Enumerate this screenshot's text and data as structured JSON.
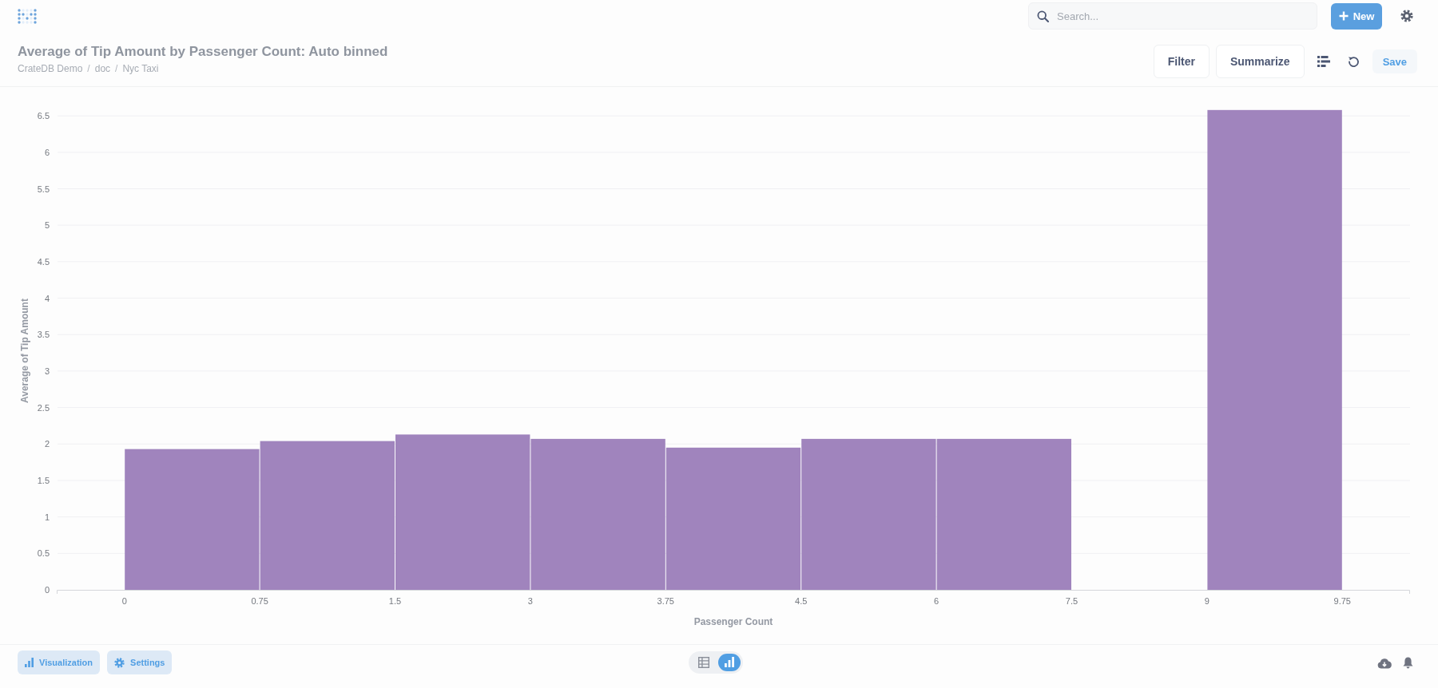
{
  "top_nav": {
    "search": {
      "placeholder": "Search..."
    },
    "new_button": {
      "label": "New"
    }
  },
  "question": {
    "title": "Average of Tip Amount by Passenger Count: Auto binned",
    "breadcrumb": [
      {
        "text": "CrateDB Demo",
        "separator": "/"
      },
      {
        "text": "doc",
        "separator": "/"
      },
      {
        "text": "Nyc Taxi"
      }
    ],
    "buttons": [
      "Filter",
      "Summarize"
    ],
    "save_button": {
      "label": "Save"
    }
  },
  "chart": {
    "chart_data": {
      "type": "bar",
      "xlabel": "Passenger Count",
      "ylabel": "Average of Tip Amount",
      "categories": [
        "0",
        "0.75",
        "1.5",
        "3",
        "3.75",
        "4.5",
        "6",
        "7.5",
        "9",
        "9.75"
      ],
      "series": [
        {
          "color": "#a084bd",
          "values": [
            1.93,
            2.04,
            2.13,
            2.07,
            1.95,
            2.07,
            2.07,
            null,
            6.58,
            null
          ]
        }
      ],
      "yticks": [
        0,
        0.5,
        1,
        1.5,
        2,
        2.5,
        3,
        3.5,
        4,
        4.5,
        5,
        5.5,
        6,
        6.5
      ],
      "ylim": [
        0,
        6.6
      ],
      "grid": true
    }
  },
  "footer": {
    "buttons": [
      {
        "label": "Visualization"
      },
      {
        "label": "Settings"
      }
    ],
    "view_toggle": [
      {
        "selected": false
      },
      {
        "selected": true
      }
    ]
  }
}
